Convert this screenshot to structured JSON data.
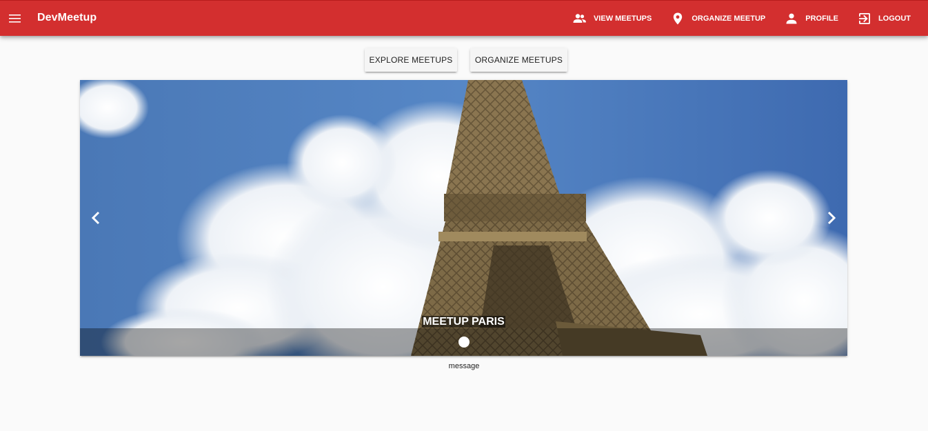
{
  "toolbar": {
    "menu_icon": "menu-icon",
    "title": "DevMeetup",
    "color": "#d32f2f",
    "nav": [
      {
        "label": "View Meetups",
        "icon": "people-icon"
      },
      {
        "label": "Organize Meetup",
        "icon": "location-pin-icon"
      },
      {
        "label": "Profile",
        "icon": "person-icon"
      },
      {
        "label": "Logout",
        "icon": "exit-icon"
      }
    ]
  },
  "actions": {
    "explore_label": "Explore Meetups",
    "organize_label": "Organize Meetups"
  },
  "carousel": {
    "slide_title": "Meetup Paris",
    "prev_icon": "chevron-left-icon",
    "next_icon": "chevron-right-icon",
    "slides_count": 1,
    "active_slide": 1
  },
  "footer_text": "message"
}
